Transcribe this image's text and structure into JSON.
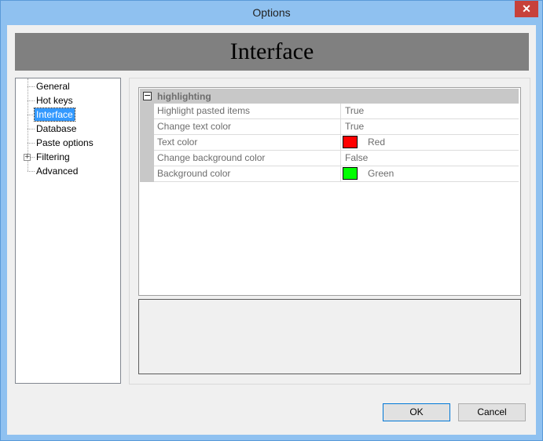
{
  "window": {
    "title": "Options",
    "close_glyph": "✕"
  },
  "banner": {
    "title": "Interface"
  },
  "tree": {
    "items": [
      {
        "label": "General"
      },
      {
        "label": "Hot keys"
      },
      {
        "label": "Interface",
        "selected": true
      },
      {
        "label": "Database"
      },
      {
        "label": "Paste options"
      },
      {
        "label": "Filtering",
        "expandable": true,
        "expander_glyph": "+"
      },
      {
        "label": "Advanced"
      }
    ]
  },
  "grid": {
    "category": {
      "label": "highlighting",
      "toggle_glyph": "−"
    },
    "rows": [
      {
        "name": "Highlight pasted items",
        "value": "True"
      },
      {
        "name": "Change text color",
        "value": "True"
      },
      {
        "name": "Text color",
        "value": "Red",
        "swatch": "#ff0000"
      },
      {
        "name": "Change background color",
        "value": "False"
      },
      {
        "name": "Background color",
        "value": "Green",
        "swatch": "#00ff00"
      }
    ]
  },
  "buttons": {
    "ok": "OK",
    "cancel": "Cancel"
  }
}
